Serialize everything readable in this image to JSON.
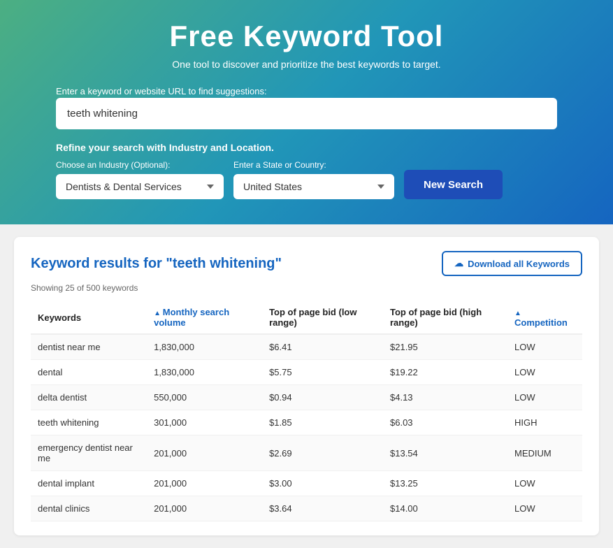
{
  "hero": {
    "title": "Free Keyword Tool",
    "subtitle": "One tool to discover and prioritize the best keywords to target.",
    "input_label": "Enter a keyword or website URL to find suggestions:",
    "input_value": "teeth whitening",
    "input_placeholder": "teeth whitening",
    "refine_label": "Refine your search with Industry and Location.",
    "industry_label": "Choose an Industry (Optional):",
    "industry_value": "Dentists & Dental Services",
    "state_label": "Enter a State or Country:",
    "state_value": "United States",
    "new_search_label": "New Search"
  },
  "results": {
    "title": "Keyword results for \"teeth whitening\"",
    "showing_text": "Showing 25 of 500 keywords",
    "download_label": "Download all Keywords",
    "columns": [
      {
        "key": "keyword",
        "label": "Keywords",
        "sortable": false
      },
      {
        "key": "volume",
        "label": "Monthly search volume",
        "sortable": true
      },
      {
        "key": "bid_low",
        "label": "Top of page bid (low range)",
        "sortable": false
      },
      {
        "key": "bid_high",
        "label": "Top of page bid (high range)",
        "sortable": false
      },
      {
        "key": "competition",
        "label": "Competition",
        "sortable": true
      }
    ],
    "rows": [
      {
        "keyword": "dentist near me",
        "volume": "1,830,000",
        "bid_low": "$6.41",
        "bid_high": "$21.95",
        "competition": "LOW"
      },
      {
        "keyword": "dental",
        "volume": "1,830,000",
        "bid_low": "$5.75",
        "bid_high": "$19.22",
        "competition": "LOW"
      },
      {
        "keyword": "delta dentist",
        "volume": "550,000",
        "bid_low": "$0.94",
        "bid_high": "$4.13",
        "competition": "LOW"
      },
      {
        "keyword": "teeth whitening",
        "volume": "301,000",
        "bid_low": "$1.85",
        "bid_high": "$6.03",
        "competition": "HIGH"
      },
      {
        "keyword": "emergency dentist near me",
        "volume": "201,000",
        "bid_low": "$2.69",
        "bid_high": "$13.54",
        "competition": "MEDIUM"
      },
      {
        "keyword": "dental implant",
        "volume": "201,000",
        "bid_low": "$3.00",
        "bid_high": "$13.25",
        "competition": "LOW"
      },
      {
        "keyword": "dental clinics",
        "volume": "201,000",
        "bid_low": "$3.64",
        "bid_high": "$14.00",
        "competition": "LOW"
      }
    ]
  }
}
